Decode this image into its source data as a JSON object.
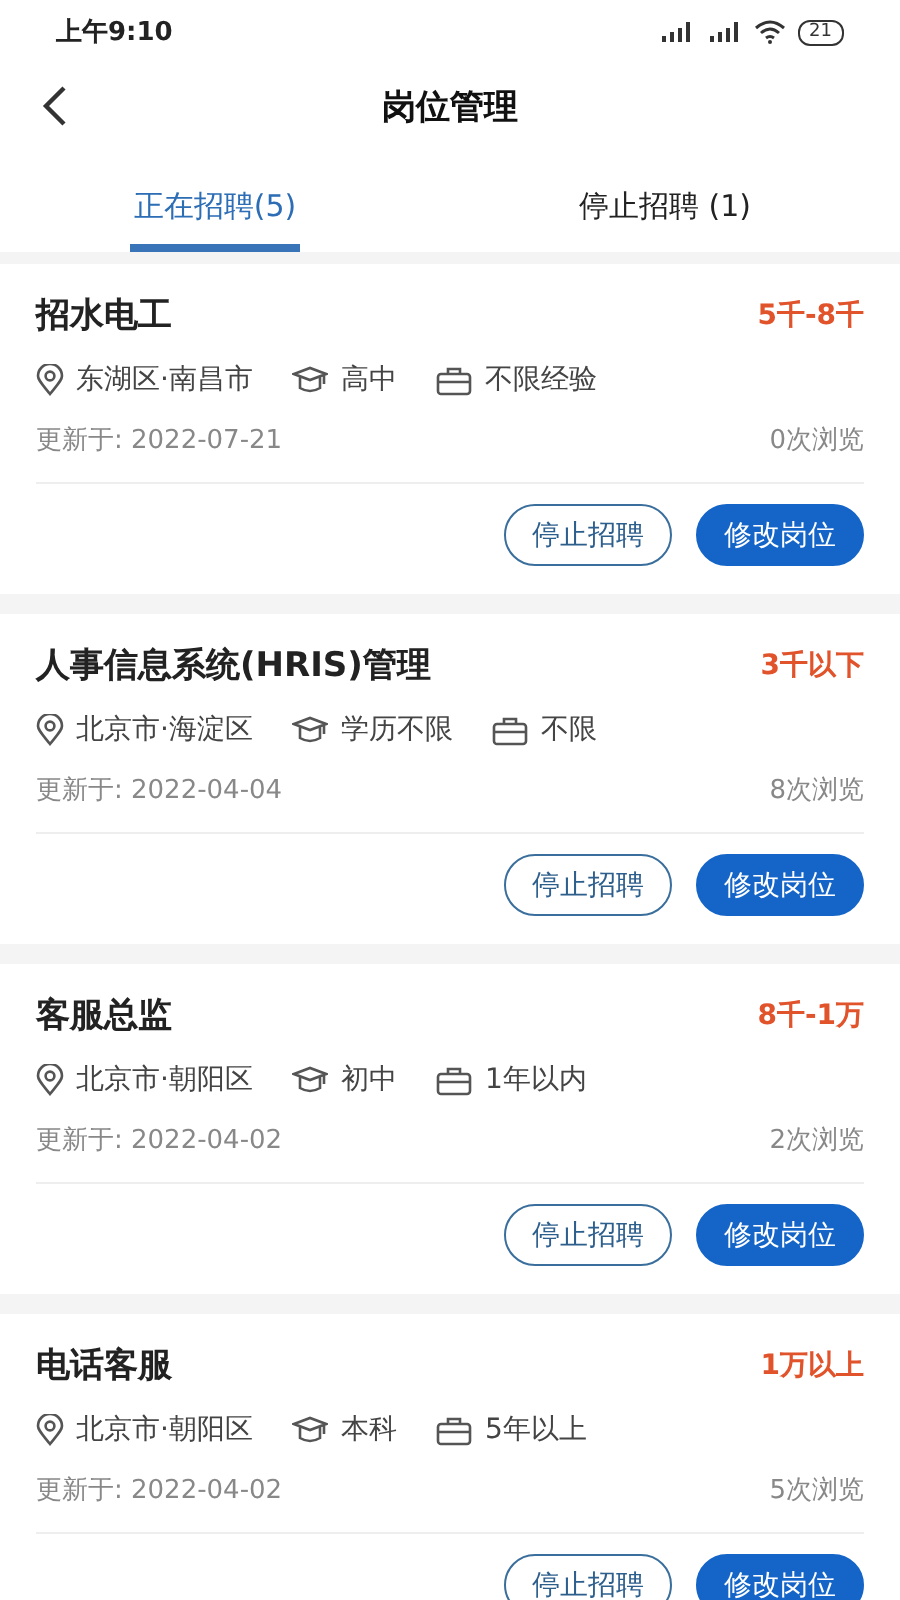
{
  "status_bar": {
    "time": "上午9:10",
    "battery": "21"
  },
  "header": {
    "title": "岗位管理"
  },
  "tabs": [
    {
      "label": "正在招聘(5)",
      "selected": true
    },
    {
      "label": "停止招聘 (1)",
      "selected": false
    }
  ],
  "jobs": [
    {
      "title": "招水电工",
      "salary": "5千-8千",
      "location": "东湖区·南昌市",
      "education": "高中",
      "experience": "不限经验",
      "updated": "更新于: 2022-07-21",
      "views": "0次浏览",
      "buttons": [
        "停止招聘",
        "修改岗位"
      ]
    },
    {
      "title": "人事信息系统(HRIS)管理",
      "salary": "3千以下",
      "location": "北京市·海淀区",
      "education": "学历不限",
      "experience": "不限",
      "updated": "更新于: 2022-04-04",
      "views": "8次浏览",
      "buttons": [
        "停止招聘",
        "修改岗位"
      ]
    },
    {
      "title": "客服总监",
      "salary": "8千-1万",
      "location": "北京市·朝阳区",
      "education": "初中",
      "experience": "1年以内",
      "updated": "更新于: 2022-04-02",
      "views": "2次浏览",
      "buttons": [
        "停止招聘",
        "修改岗位"
      ]
    },
    {
      "title": "电话客服",
      "salary": "1万以上",
      "location": "北京市·朝阳区",
      "education": "本科",
      "experience": "5年以上",
      "updated": "更新于: 2022-04-02",
      "views": "5次浏览",
      "buttons": [
        "停止招聘",
        "修改岗位"
      ]
    }
  ]
}
